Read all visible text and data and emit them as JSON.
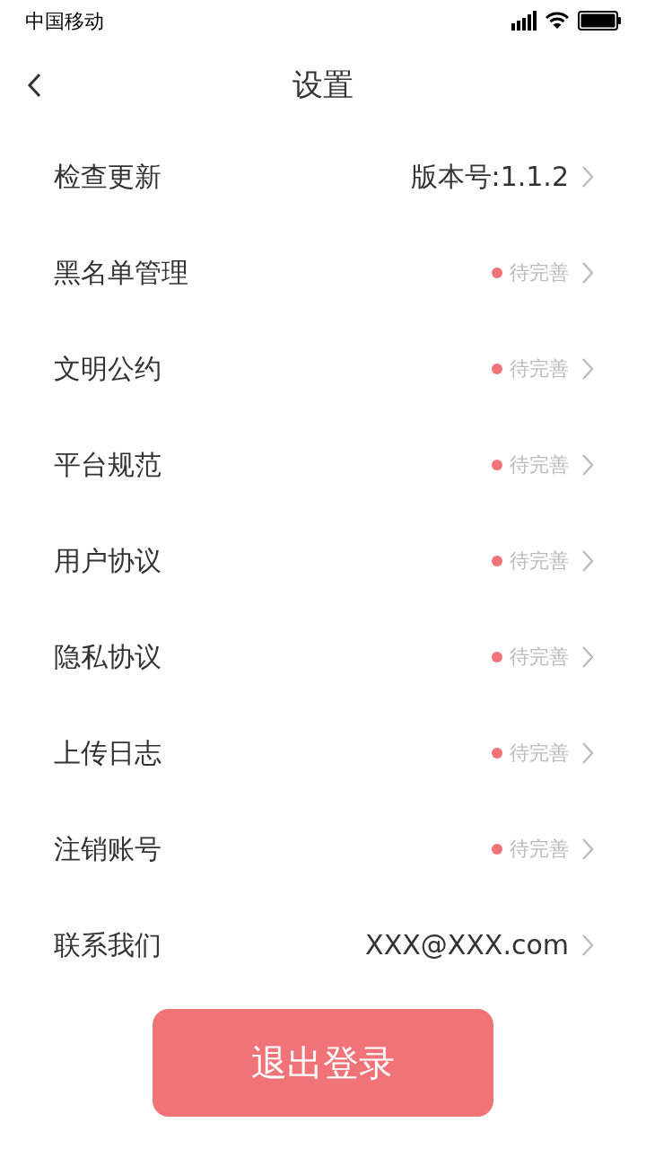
{
  "status_bar": {
    "carrier": "中国移动"
  },
  "nav": {
    "title": "设置"
  },
  "items": [
    {
      "label": "检查更新",
      "kind": "value",
      "value": "版本号:1.1.2"
    },
    {
      "label": "黑名单管理",
      "kind": "pending",
      "value": "待完善"
    },
    {
      "label": "文明公约",
      "kind": "pending",
      "value": "待完善"
    },
    {
      "label": "平台规范",
      "kind": "pending",
      "value": "待完善"
    },
    {
      "label": "用户协议",
      "kind": "pending",
      "value": "待完善"
    },
    {
      "label": "隐私协议",
      "kind": "pending",
      "value": "待完善"
    },
    {
      "label": "上传日志",
      "kind": "pending",
      "value": "待完善"
    },
    {
      "label": "注销账号",
      "kind": "pending",
      "value": "待完善"
    },
    {
      "label": "联系我们",
      "kind": "value",
      "value": "XXX@XXX.com"
    }
  ],
  "logout_button": "退出登录"
}
